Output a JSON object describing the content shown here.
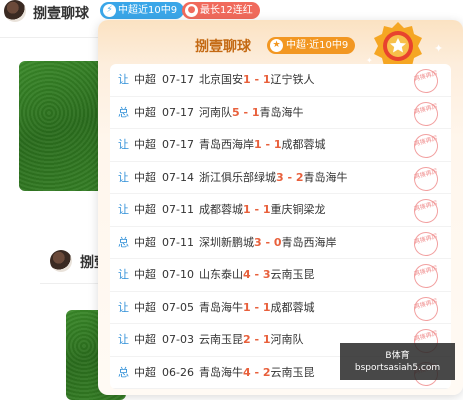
{
  "poster": {
    "name": "捌壹聊球"
  },
  "tags": [
    {
      "label": "中超近10中9",
      "icon": "lightning-icon"
    },
    {
      "label": "最长12连红",
      "icon": "flame-icon"
    }
  ],
  "popup": {
    "title": "捌壹聊球",
    "badge": "中超·近10中9",
    "medal_text": "★"
  },
  "records": [
    {
      "type": "让",
      "league": "中超",
      "date": "07-17",
      "home": "北京国安",
      "home_score": "1",
      "sep": " - ",
      "away_score": "1",
      "away": "辽宁铁人",
      "stamp": "再接再厉"
    },
    {
      "type": "总",
      "league": "中超",
      "date": "07-17",
      "home": "河南队",
      "home_score": "5",
      "sep": " - ",
      "away_score": "1",
      "away": "青岛海牛",
      "stamp": "再接再厉"
    },
    {
      "type": "让",
      "league": "中超",
      "date": "07-17",
      "home": "青岛西海岸",
      "home_score": "1",
      "sep": " - ",
      "away_score": "1",
      "away": "成都蓉城",
      "stamp": "再接再厉"
    },
    {
      "type": "让",
      "league": "中超",
      "date": "07-14",
      "home": "浙江俱乐部绿城",
      "home_score": "3",
      "sep": " - ",
      "away_score": "2",
      "away": "青岛海牛",
      "stamp": "再接再厉"
    },
    {
      "type": "让",
      "league": "中超",
      "date": "07-11",
      "home": "成都蓉城",
      "home_score": "1",
      "sep": " - ",
      "away_score": "1",
      "away": "重庆铜梁龙",
      "stamp": "再接再厉"
    },
    {
      "type": "总",
      "league": "中超",
      "date": "07-11",
      "home": "深圳新鹏城",
      "home_score": "3",
      "sep": " - ",
      "away_score": "0",
      "away": "青岛西海岸",
      "stamp": "再接再厉"
    },
    {
      "type": "让",
      "league": "中超",
      "date": "07-10",
      "home": "山东泰山",
      "home_score": "4",
      "sep": " - ",
      "away_score": "3",
      "away": "云南玉昆",
      "stamp": "再接再厉"
    },
    {
      "type": "让",
      "league": "中超",
      "date": "07-05",
      "home": "青岛海牛",
      "home_score": "1",
      "sep": " - ",
      "away_score": "1",
      "away": "成都蓉城",
      "stamp": "再接再厉"
    },
    {
      "type": "让",
      "league": "中超",
      "date": "07-03",
      "home": "云南玉昆",
      "home_score": "2",
      "sep": " - ",
      "away_score": "1",
      "away": "河南队",
      "stamp": "再接再厉"
    },
    {
      "type": "总",
      "league": "中超",
      "date": "06-26",
      "home": "青岛海牛",
      "home_score": "4",
      "sep": " - ",
      "away_score": "2",
      "away": "云南玉昆",
      "stamp": "再接再厉"
    }
  ],
  "second_poster": {
    "name": "捌壹"
  },
  "watermark": {
    "line1": "B体育",
    "line2": "bsportsasiah5.com"
  },
  "colors": {
    "accent": "#e8603c",
    "type_blue": "#2f8fd8",
    "title_orange": "#c46a14",
    "badge_orange": "#f29722"
  }
}
